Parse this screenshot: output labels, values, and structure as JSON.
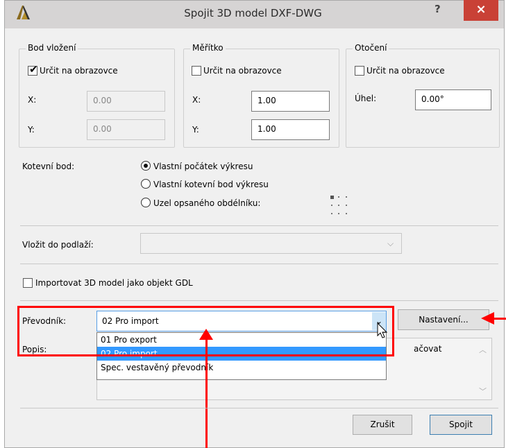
{
  "window": {
    "title": "Spojit 3D model DXF-DWG",
    "help_label": "?",
    "close_label": "×"
  },
  "insertion_point": {
    "legend": "Bod vložení",
    "checkbox_label": "Určit na obrazovce",
    "checked": true,
    "x_label": "X:",
    "x_value": "0.00",
    "y_label": "Y:",
    "y_value": "0.00"
  },
  "scale": {
    "legend": "Měřítko",
    "checkbox_label": "Určit na obrazovce",
    "checked": false,
    "x_label": "X:",
    "x_value": "1.00",
    "y_label": "Y:",
    "y_value": "1.00"
  },
  "rotation": {
    "legend": "Otočení",
    "checkbox_label": "Určit na obrazovce",
    "checked": false,
    "angle_label": "Úhel:",
    "angle_value": "0.00°"
  },
  "anchor": {
    "label": "Kotevní bod:",
    "options": [
      "Vlastní počátek výkresu",
      "Vlastní kotevní bod výkresu",
      "Uzel opsaného obdélníku:"
    ],
    "selected_index": 0
  },
  "floor": {
    "label": "Vložit do podlaží:",
    "value": ""
  },
  "gdl": {
    "label": "Importovat 3D model jako objekt GDL",
    "checked": false
  },
  "converter": {
    "label": "Převodník:",
    "value": "02 Pro import",
    "settings_button": "Nastavení...",
    "options": [
      "01 Pro export",
      "02 Pro import",
      "Spec. vestavěný převodník"
    ],
    "selected_index": 1
  },
  "description": {
    "label": "Popis:",
    "visible_text": "ačovat"
  },
  "buttons": {
    "cancel": "Zrušit",
    "merge": "Spojit"
  },
  "colors": {
    "highlight": "#ff0000",
    "selection": "#3399ff",
    "close": "#c94136"
  }
}
